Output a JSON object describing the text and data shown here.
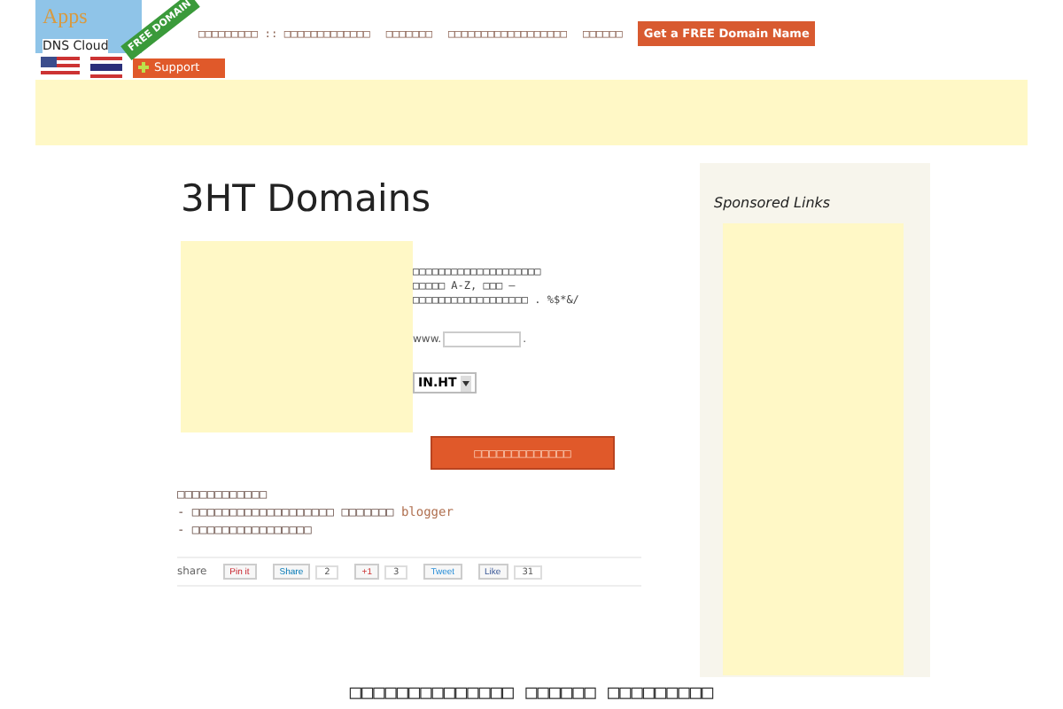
{
  "logo": {
    "brand": "Apps",
    "badge": "FREE DOMAIN",
    "caption": "DNS Cloud"
  },
  "nav": [
    {
      "label": "□□□□□□□□□ :: □□□□□□□□□□□□□",
      "kind": "link"
    },
    {
      "label": "□□□□□□□",
      "kind": "link"
    },
    {
      "label": "□□□□□□□□□□□□□□□□□□",
      "kind": "link"
    },
    {
      "label": "□□□□□□",
      "kind": "link"
    },
    {
      "label": "Get a FREE Domain Name",
      "kind": "cta"
    }
  ],
  "support_button": "Support",
  "page_title": "3HT Domains",
  "form": {
    "instructions": [
      "□□□□□□□□□□□□□□□□□□□□",
      "□□□□□ A-Z, □□□ –",
      "□□□□□□□□□□□□□□□□□□ . %$*&/"
    ],
    "prefix": "www.",
    "suffix": ".",
    "extension": "IN.HT",
    "submit": "□□□□□□□□□□□□□"
  },
  "notes": {
    "heading": "□□□□□□□□□□□□",
    "items": [
      {
        "text": "- □□□□□□□□□□□□□□□□□□□ □□□□□□□ ",
        "link": "blogger"
      },
      {
        "text": "- □□□□□□□□□□□□□□□□"
      }
    ]
  },
  "share": {
    "label": "share",
    "buttons": [
      {
        "kind": "pinterest",
        "label": "Pin it"
      },
      {
        "kind": "linkedin",
        "label": "Share",
        "count": "2"
      },
      {
        "kind": "gplus",
        "label": "+1",
        "count": "3"
      },
      {
        "kind": "twitter",
        "label": "Tweet"
      },
      {
        "kind": "facebook",
        "label": "Like",
        "count": "31"
      }
    ]
  },
  "sidebar": {
    "title": "Sponsored Links"
  },
  "footer_heading": "□□□□□□□□□□□□□□ □□□□□□ □□□□□□□□□"
}
